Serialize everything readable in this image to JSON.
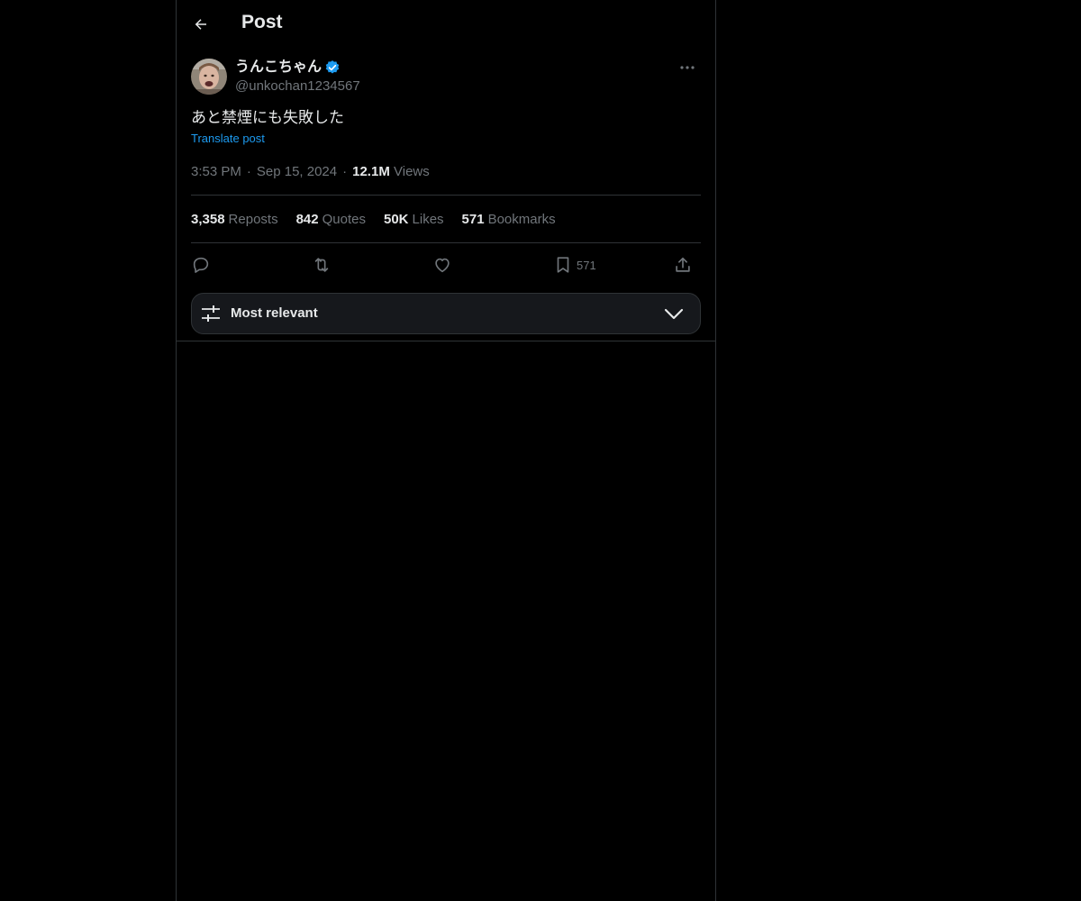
{
  "header": {
    "title": "Post"
  },
  "author": {
    "display_name": "うんこちゃん",
    "handle": "@unkochan1234567",
    "verified": true
  },
  "post": {
    "text": "あと禁煙にも失敗した",
    "translate_label": "Translate post",
    "time": "3:53 PM",
    "date": "Sep 15, 2024",
    "views_count": "12.1M",
    "views_label": "Views"
  },
  "stats": {
    "reposts_count": "3,358",
    "reposts_label": "Reposts",
    "quotes_count": "842",
    "quotes_label": "Quotes",
    "likes_count": "50K",
    "likes_label": "Likes",
    "bookmarks_count": "571",
    "bookmarks_label": "Bookmarks"
  },
  "actions": {
    "reply_icon": "reply-icon",
    "repost_icon": "repost-icon",
    "like_icon": "heart-icon",
    "bookmark_icon": "bookmark-icon",
    "bookmark_count": "571",
    "share_icon": "share-icon"
  },
  "sort": {
    "label": "Most relevant"
  },
  "colors": {
    "background": "#000000",
    "text_primary": "#e7e9ea",
    "text_secondary": "#71767b",
    "accent": "#1d9bf0",
    "border": "#2f3336",
    "sort_bg": "#16181c"
  }
}
